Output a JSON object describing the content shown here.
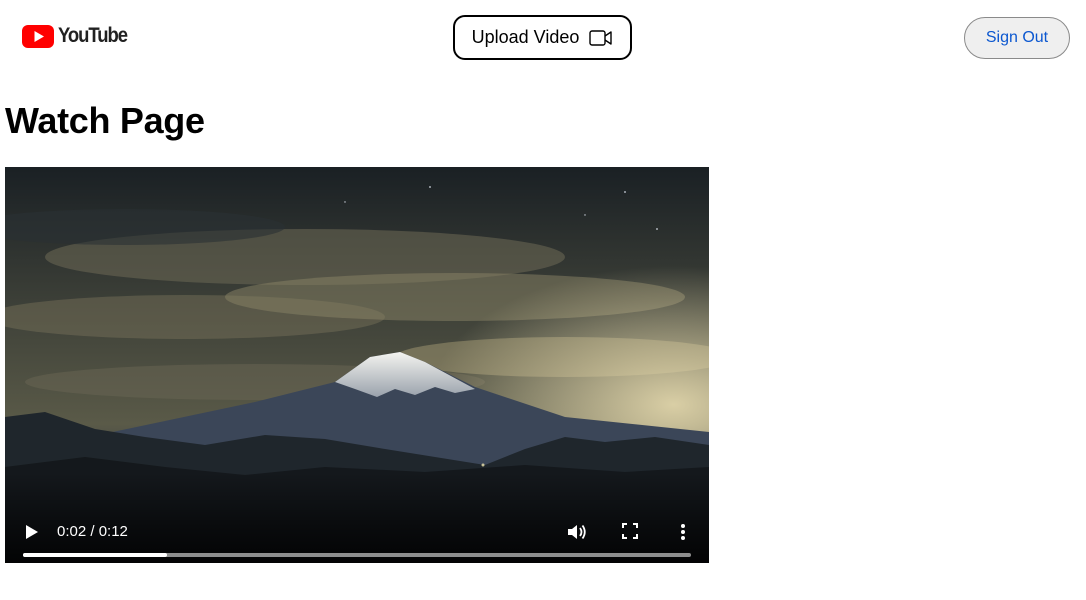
{
  "header": {
    "logo_text": "YouTube",
    "upload_label": "Upload Video",
    "signout_label": "Sign Out"
  },
  "main": {
    "title": "Watch Page"
  },
  "video": {
    "time_display": "0:02 / 0:12",
    "progress_fraction": 0.215,
    "icons": [
      "play-icon",
      "volume-icon",
      "fullscreen-icon",
      "more-options-icon",
      "video-camera-icon"
    ]
  },
  "colors": {
    "brand_red": "#ff0000",
    "link_blue": "#0b57d0"
  }
}
